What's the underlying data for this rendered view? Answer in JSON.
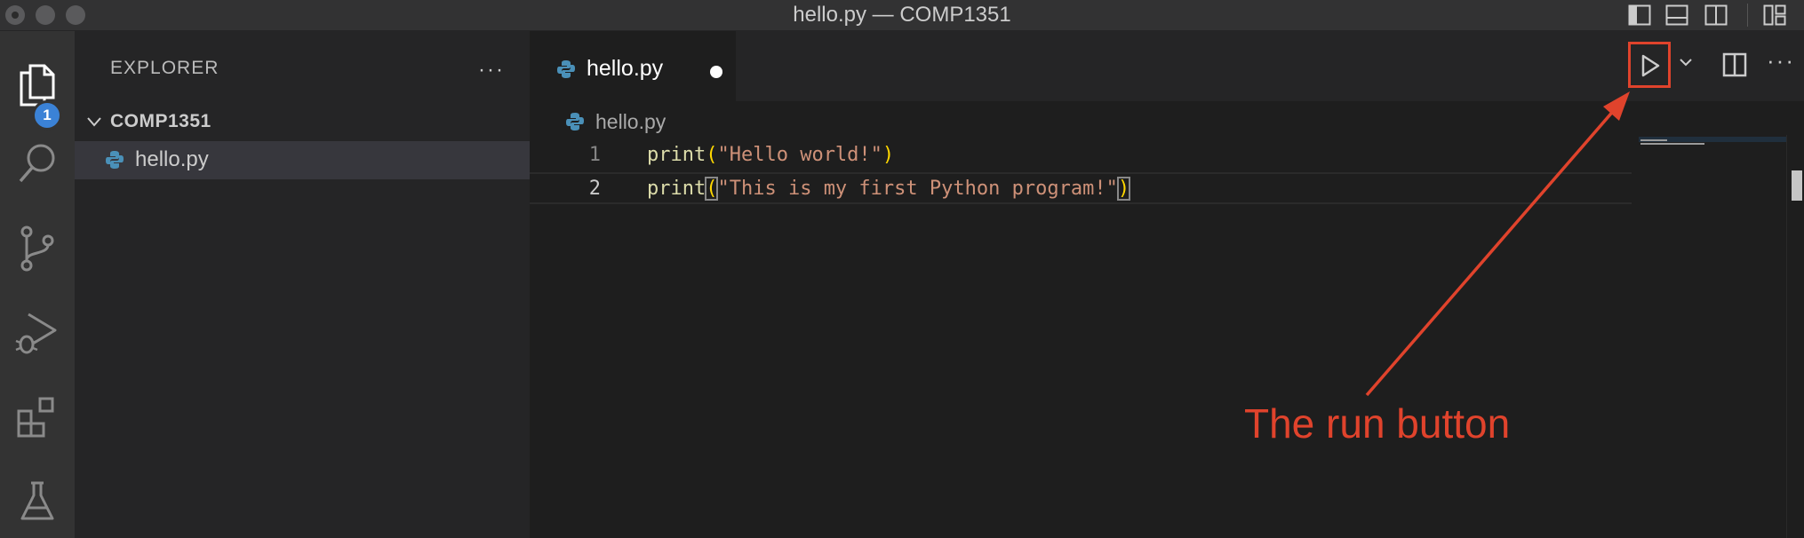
{
  "window": {
    "title": "hello.py — COMP1351"
  },
  "activity_bar": {
    "explorer_badge": "1",
    "items": [
      "explorer-icon",
      "search-icon",
      "source-control-icon",
      "run-debug-icon",
      "extensions-icon",
      "testing-icon"
    ]
  },
  "sidebar": {
    "title": "EXPLORER",
    "more": "···",
    "folder": "COMP1351",
    "files": [
      {
        "name": "hello.py"
      }
    ]
  },
  "editor": {
    "tab": {
      "label": "hello.py",
      "modified": true
    },
    "actions_more": "···",
    "breadcrumb": "hello.py",
    "lines": [
      {
        "number": "1",
        "fn": "print",
        "open": "(",
        "str": "\"Hello world!\"",
        "close": ")"
      },
      {
        "number": "2",
        "fn": "print",
        "open": "(",
        "str": "\"This is my first Python program!\"",
        "close": ")"
      }
    ]
  },
  "annotation": {
    "text": "The run button",
    "color": "#e0432c"
  },
  "colors": {
    "accent_badge": "#3b82d6",
    "annotation": "#e0432c",
    "python_icon": "#4a90b8"
  }
}
